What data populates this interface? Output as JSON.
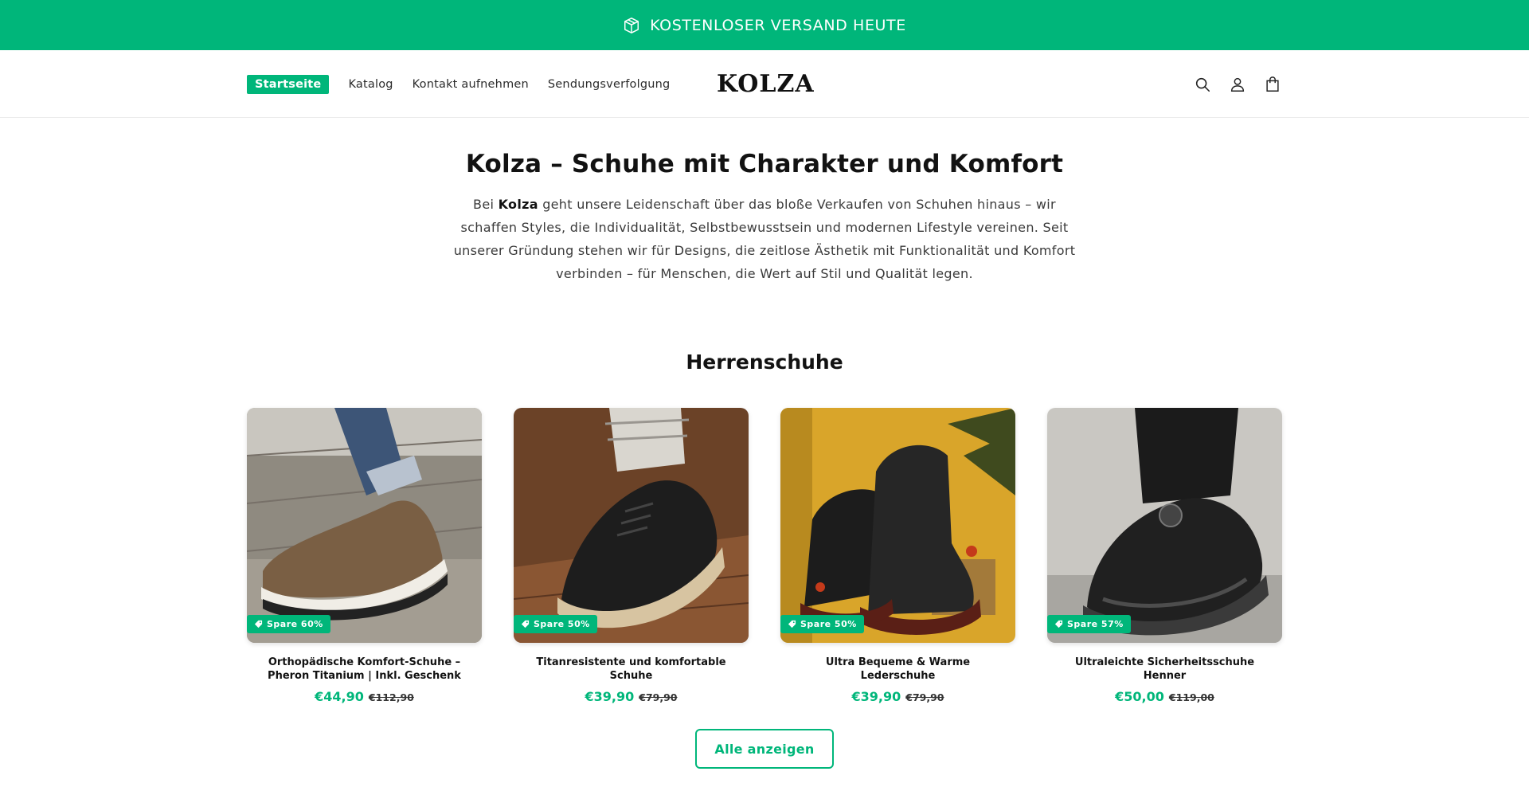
{
  "announcement": {
    "text": "KOSTENLOSER VERSAND HEUTE",
    "icon": "package-icon"
  },
  "header": {
    "nav": [
      "Startseite",
      "Katalog",
      "Kontakt aufnehmen",
      "Sendungsverfolgung"
    ],
    "active_nav": "Startseite",
    "logo": "KOLZA",
    "icons": [
      "search-icon",
      "account-icon",
      "cart-icon"
    ]
  },
  "intro": {
    "title": "Kolza – Schuhe mit Charakter und Komfort",
    "text_before_brand": "Bei ",
    "brand": "Kolza",
    "text_after_brand": " geht unsere Leidenschaft über das bloße Verkaufen von Schuhen hinaus – wir schaffen Styles, die Individualität, Selbstbewusstsein und modernen Lifestyle vereinen. Seit unserer Gründung stehen wir für Designs, die zeitlose Ästhetik mit Funktionalität und Komfort verbinden – für Menschen, die Wert auf Stil und Qualität legen."
  },
  "collection": {
    "title": "Herrenschuhe",
    "products": [
      {
        "badge": "Spare 60%",
        "title": "Orthopädische Komfort-Schuhe – Pheron Titanium | Inkl. Geschenk",
        "price": "€44,90",
        "old_price": "€112,90",
        "image": "brown slip-on comfort shoe on wooden boardwalk"
      },
      {
        "badge": "Spare 50%",
        "title": "Titanresistente und komfortable Schuhe",
        "price": "€39,90",
        "old_price": "€79,90",
        "image": "black canvas sneaker with beige sole on wooden floor"
      },
      {
        "badge": "Spare 50%",
        "title": "Ultra Bequeme & Warme Lederschuhe",
        "price": "€39,90",
        "old_price": "€79,90",
        "image": "black leather high-top boots on yellow background"
      },
      {
        "badge": "Spare 57%",
        "title": "Ultraleichte Sicherheitsschuhe Henner",
        "price": "€50,00",
        "old_price": "€119,00",
        "image": "black chunky safety sneaker with dial lacing"
      }
    ],
    "view_all": "Alle anzeigen"
  },
  "colors": {
    "accent": "#00b67a",
    "text": "#121212"
  }
}
